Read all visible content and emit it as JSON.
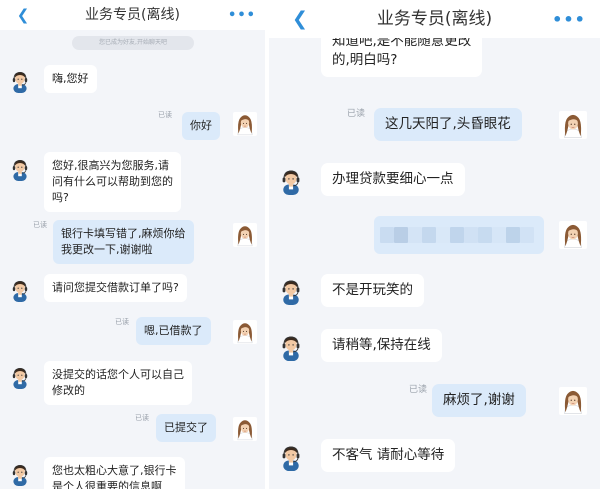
{
  "window": {
    "title": "业务专员(离线)",
    "back_icon": "back-chevron-icon",
    "more_icon": "more-dots-icon",
    "accent_color": "#2f8ed8"
  },
  "colors": {
    "background": "#f3f5f9",
    "incoming_bubble": "#ffffff",
    "outgoing_bubble": "#dbeafa"
  },
  "left_chat": {
    "system_note": "您已成为好友,开始聊天吧",
    "messages": [
      {
        "from": "agent",
        "text": "嗨,您好"
      },
      {
        "from": "user",
        "status": "已读",
        "text": "你好"
      },
      {
        "from": "agent",
        "text": "您好,很高兴为您服务,请\n问有什么可以帮助到您的\n吗?"
      },
      {
        "from": "user",
        "status": "已读",
        "text": "银行卡填写错了,麻烦你给\n我更改一下,谢谢啦"
      },
      {
        "from": "agent",
        "text": "请问您提交借款订单了吗?"
      },
      {
        "from": "user",
        "status": "已读",
        "text": "嗯,已借款了"
      },
      {
        "from": "agent",
        "text": "没提交的话您个人可以自己\n修改的"
      },
      {
        "from": "user",
        "status": "已读",
        "text": "已提交了"
      },
      {
        "from": "agent",
        "text": "您也太粗心大意了,银行卡\n是个人很重要的信息啊"
      }
    ]
  },
  "right_chat": {
    "messages": [
      {
        "from": "agent",
        "text": "知道吧,是不能随意更改\n的,明白吗?"
      },
      {
        "from": "user",
        "status": "已读",
        "text": "这几天阳了,头昏眼花"
      },
      {
        "from": "agent",
        "text": "办理贷款要细心一点"
      },
      {
        "from": "user",
        "blurred": true,
        "content": "pixelated-image"
      },
      {
        "from": "agent",
        "text": "不是开玩笑的"
      },
      {
        "from": "agent",
        "text": "请稍等,保持在线"
      },
      {
        "from": "user",
        "status": "已读",
        "text": "麻烦了,谢谢"
      },
      {
        "from": "agent",
        "text": "不客气 请耐心等待"
      }
    ]
  }
}
